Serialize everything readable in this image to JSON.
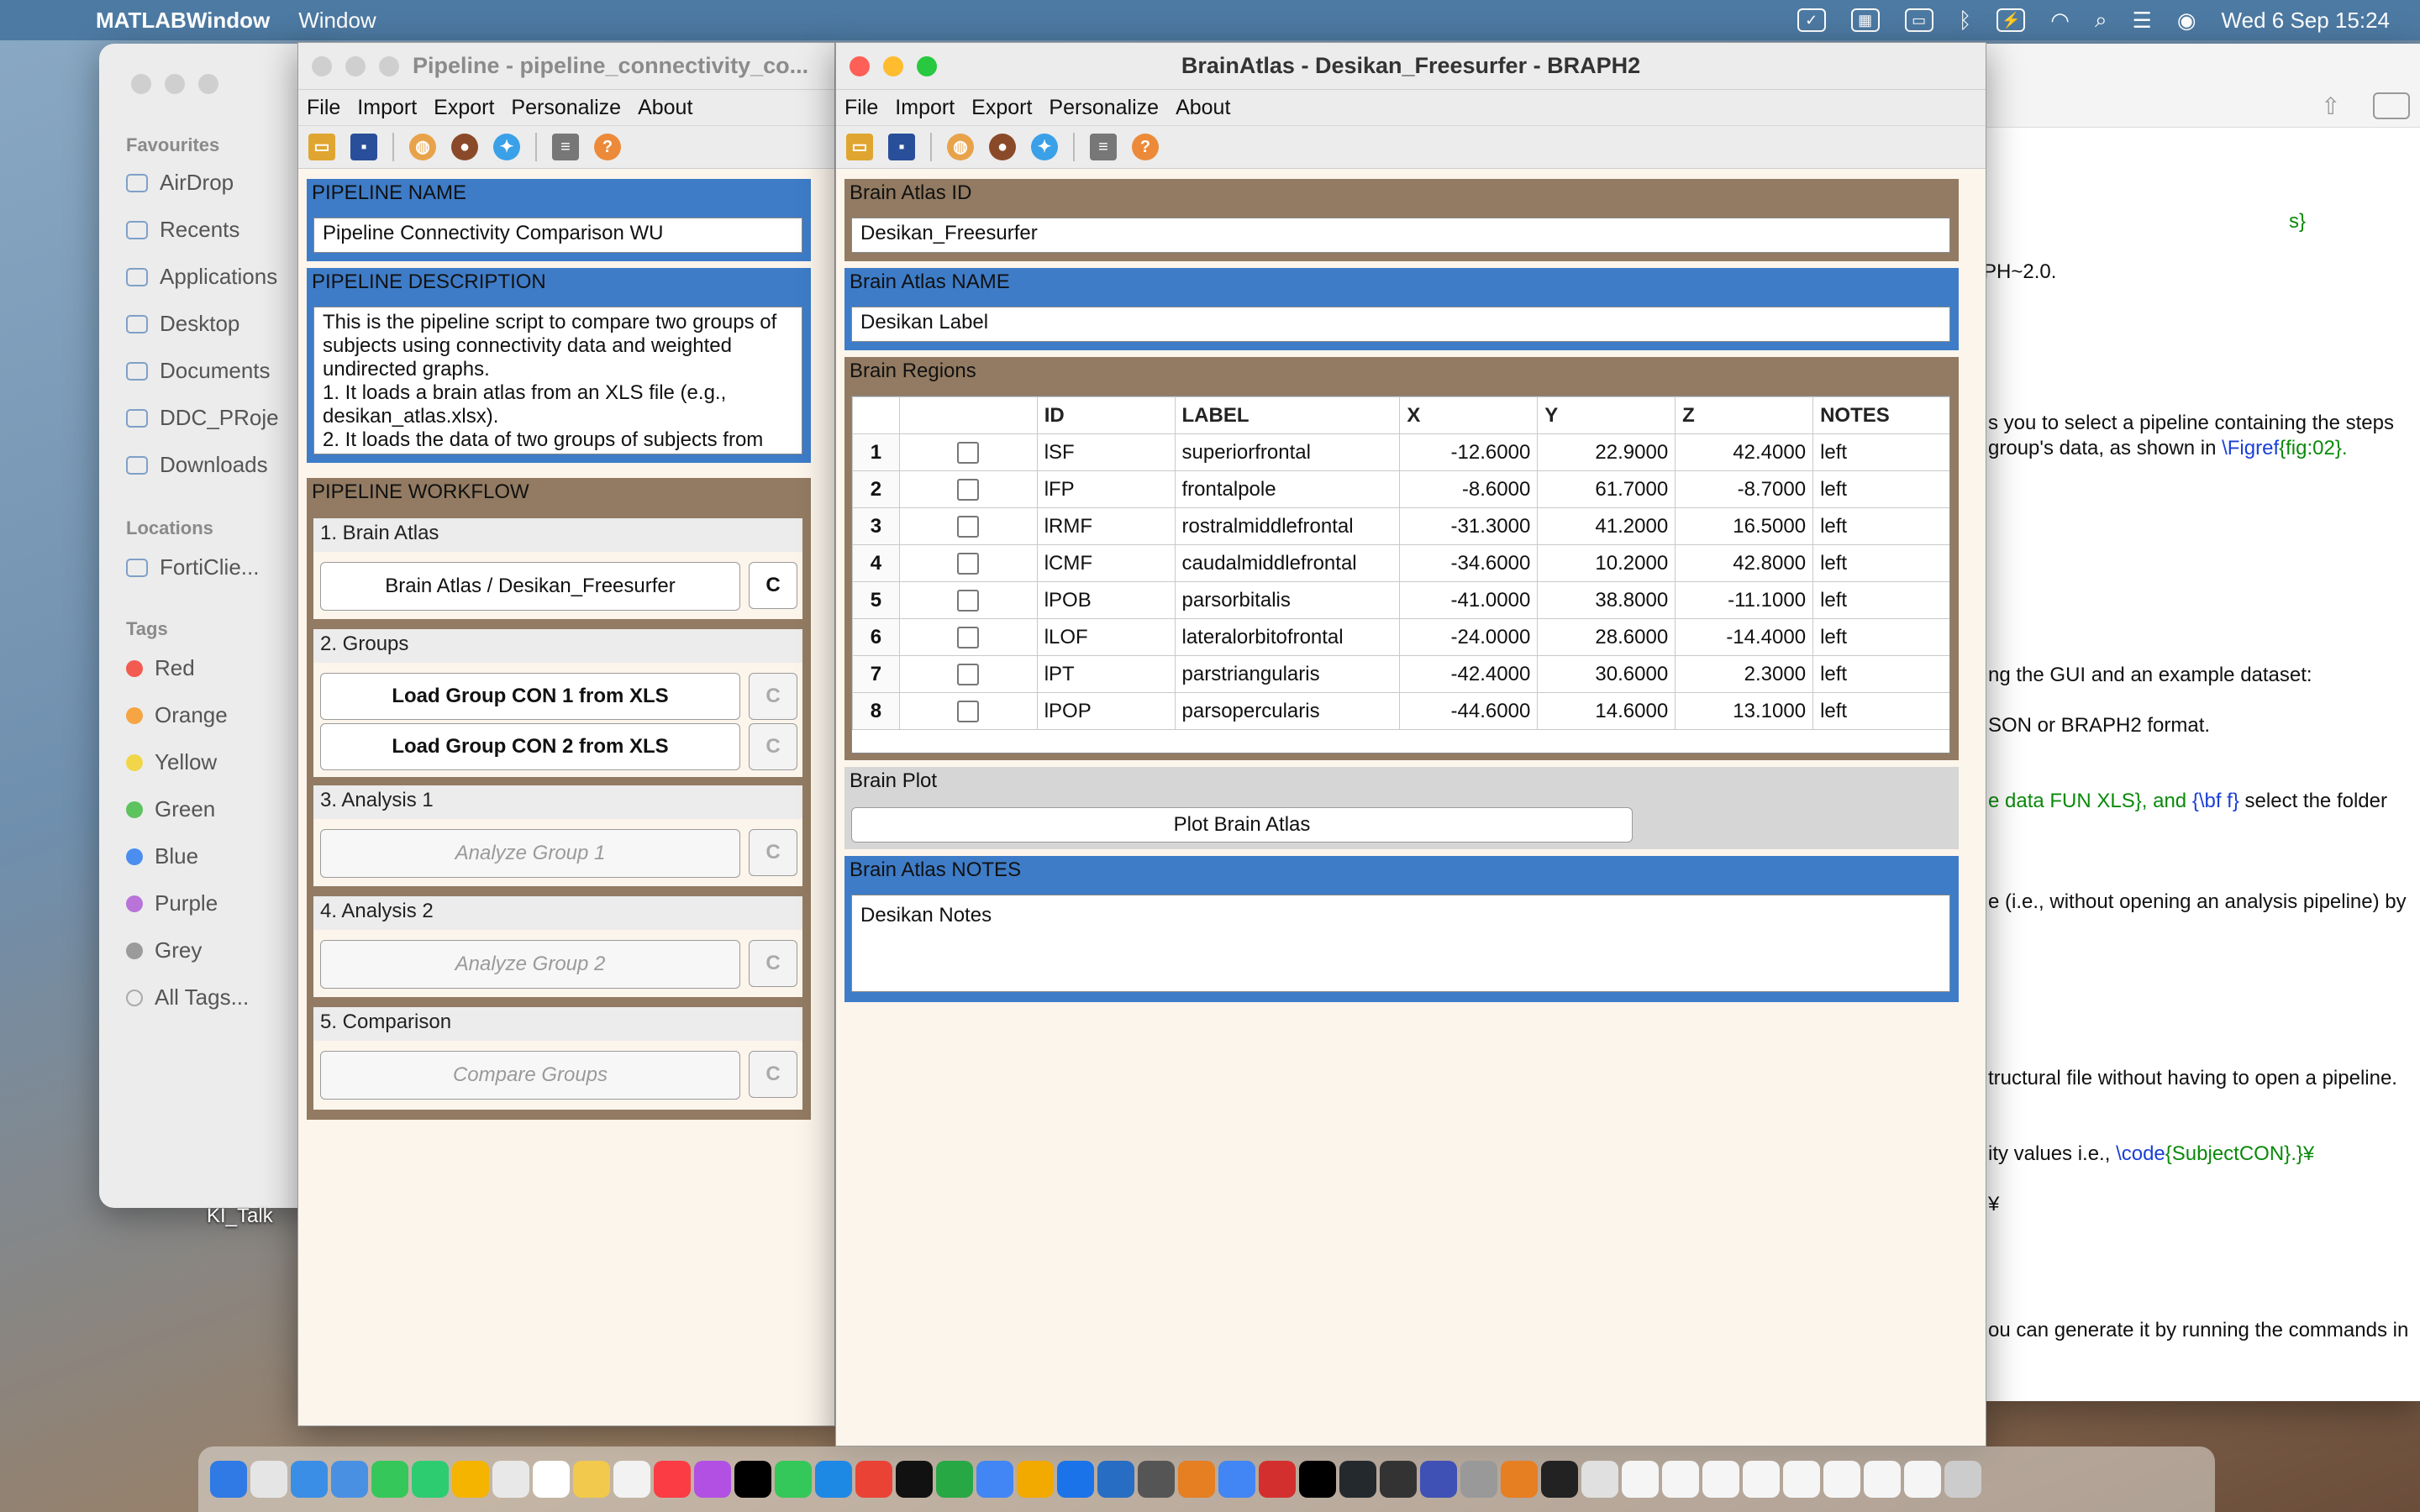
{
  "menubar": {
    "app": "MATLABWindow",
    "window_menu": "Window",
    "datetime": "Wed 6 Sep  15:24"
  },
  "finder": {
    "favourites_label": "Favourites",
    "favourites": [
      "AirDrop",
      "Recents",
      "Applications",
      "Desktop",
      "Documents",
      "DDC_PRoje",
      "Downloads"
    ],
    "locations_label": "Locations",
    "locations": [
      "FortiClie..."
    ],
    "tags_label": "Tags",
    "tags": [
      {
        "label": "Red",
        "color": "#f25b4f"
      },
      {
        "label": "Orange",
        "color": "#f5a543"
      },
      {
        "label": "Yellow",
        "color": "#f1d64a"
      },
      {
        "label": "Green",
        "color": "#5cc35e"
      },
      {
        "label": "Blue",
        "color": "#4b8ef0"
      },
      {
        "label": "Purple",
        "color": "#b874d8"
      },
      {
        "label": "Grey",
        "color": "#9b9b9b"
      }
    ],
    "all_tags": "All Tags...",
    "desktop_item": "KI_Talk"
  },
  "doc": {
    "l1": "s}",
    "l2": "PH~2.0.",
    "l3": "s you to select a pipeline containing the steps",
    "l4a": " group's data, as shown in ",
    "l4b": "\\Figref",
    "l4c": "{fig:02}.",
    "l5": "ng the GUI and an example dataset:",
    "l6": "SON or BRAPH2 format.",
    "l7a": "e data FUN XLS}, and ",
    "l7b": "{\\bf f}",
    "l7c": " select the folder",
    "l8": "e (i.e., without opening an analysis pipeline) by",
    "l9": "tructural file without having to open a pipeline.",
    "l10a": "ity values i.e., ",
    "l10b": "\\code",
    "l10c": "{SubjectCON}.}¥",
    "l11": "¥",
    "l12": "ou can generate it by running the commands in"
  },
  "pipeline": {
    "title": "Pipeline - pipeline_connectivity_co...",
    "menu": [
      "File",
      "Import",
      "Export",
      "Personalize",
      "About"
    ],
    "name_label": "PIPELINE NAME",
    "name_value": "Pipeline Connectivity Comparison WU",
    "desc_label": "PIPELINE DESCRIPTION",
    "desc_lines": [
      "This is the pipeline script to compare two groups of",
      "subjects using connectivity data and weighted",
      "undirected graphs.",
      "1. It loads a brain atlas from an XLS file (e.g.,",
      "desikan_atlas.xlsx).",
      "2. It loads the data of two groups of subjects from"
    ],
    "workflow_label": "PIPELINE WORKFLOW",
    "sections": [
      {
        "head": "1. Brain Atlas",
        "buttons": [
          {
            "label": "Brain Atlas / Desikan_Freesurfer",
            "state": "normal",
            "c": "C",
            "c_enabled": true
          }
        ]
      },
      {
        "head": "2. Groups",
        "buttons": [
          {
            "label": "Load Group CON 1 from XLS",
            "state": "bold",
            "c": "C",
            "c_enabled": false
          },
          {
            "label": "Load Group CON 2 from XLS",
            "state": "bold",
            "c": "C",
            "c_enabled": false
          }
        ]
      },
      {
        "head": "3. Analysis 1",
        "buttons": [
          {
            "label": "Analyze Group 1",
            "state": "disabled",
            "c": "C",
            "c_enabled": false
          }
        ]
      },
      {
        "head": "4. Analysis 2",
        "buttons": [
          {
            "label": "Analyze Group 2",
            "state": "disabled",
            "c": "C",
            "c_enabled": false
          }
        ]
      },
      {
        "head": "5. Comparison",
        "buttons": [
          {
            "label": "Compare Groups",
            "state": "disabled",
            "c": "C",
            "c_enabled": false
          }
        ]
      }
    ]
  },
  "atlas": {
    "title": "BrainAtlas - Desikan_Freesurfer - BRAPH2",
    "menu": [
      "File",
      "Import",
      "Export",
      "Personalize",
      "About"
    ],
    "id_label": "Brain Atlas ID",
    "id_value": "Desikan_Freesurfer",
    "name_label": "Brain Atlas NAME",
    "name_value": "Desikan Label",
    "regions_label": "Brain Regions",
    "columns": [
      "",
      "",
      "ID",
      "LABEL",
      "X",
      "Y",
      "Z",
      "NOTES"
    ],
    "rows": [
      [
        "1",
        "lSF",
        "superiorfrontal",
        "-12.6000",
        "22.9000",
        "42.4000",
        "left"
      ],
      [
        "2",
        "lFP",
        "frontalpole",
        "-8.6000",
        "61.7000",
        "-8.7000",
        "left"
      ],
      [
        "3",
        "lRMF",
        "rostralmiddlefrontal",
        "-31.3000",
        "41.2000",
        "16.5000",
        "left"
      ],
      [
        "4",
        "lCMF",
        "caudalmiddlefrontal",
        "-34.6000",
        "10.2000",
        "42.8000",
        "left"
      ],
      [
        "5",
        "lPOB",
        "parsorbitalis",
        "-41.0000",
        "38.8000",
        "-11.1000",
        "left"
      ],
      [
        "6",
        "lLOF",
        "lateralorbitofrontal",
        "-24.0000",
        "28.6000",
        "-14.4000",
        "left"
      ],
      [
        "7",
        "lPT",
        "parstriangularis",
        "-42.4000",
        "30.6000",
        "2.3000",
        "left"
      ],
      [
        "8",
        "lPOP",
        "parsopercularis",
        "-44.6000",
        "14.6000",
        "13.1000",
        "left"
      ]
    ],
    "plot_label": "Brain Plot",
    "plot_button": "Plot Brain Atlas",
    "notes_label": "Brain Atlas NOTES",
    "notes_value": "Desikan Notes"
  },
  "colors": {
    "panel_blue": "#3e7cc8",
    "panel_brown": "#927b62",
    "window_bg": "#fcf5ec"
  }
}
